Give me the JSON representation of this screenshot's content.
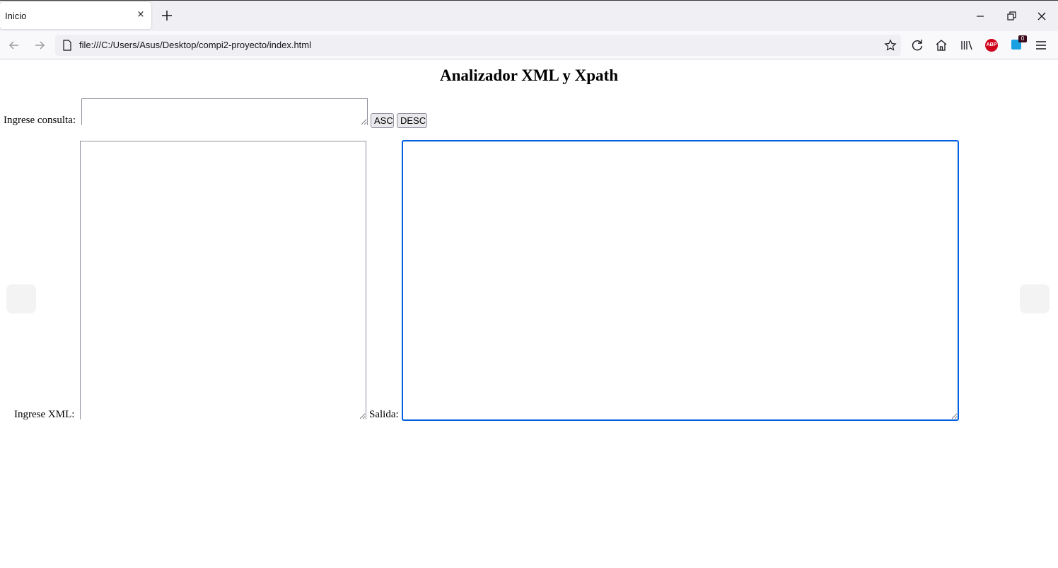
{
  "browser": {
    "tab": {
      "title": "Inicio",
      "close_icon": "×"
    },
    "url": "file:///C:/Users/Asus/Desktop/compi2-proyecto/index.html",
    "extensions": {
      "abp_label": "ABP",
      "badge_count": "0"
    }
  },
  "page": {
    "title": "Analizador XML y Xpath",
    "query_label": "Ingrese consulta:",
    "query_value": "",
    "buttons": {
      "asc": "ASC",
      "desc": "DESC"
    },
    "xml_label": "Ingrese XML:",
    "xml_value": "",
    "output_label": "Salida:",
    "output_value": ""
  },
  "colors": {
    "accent": "#0060df",
    "abp": "#d0021b"
  }
}
